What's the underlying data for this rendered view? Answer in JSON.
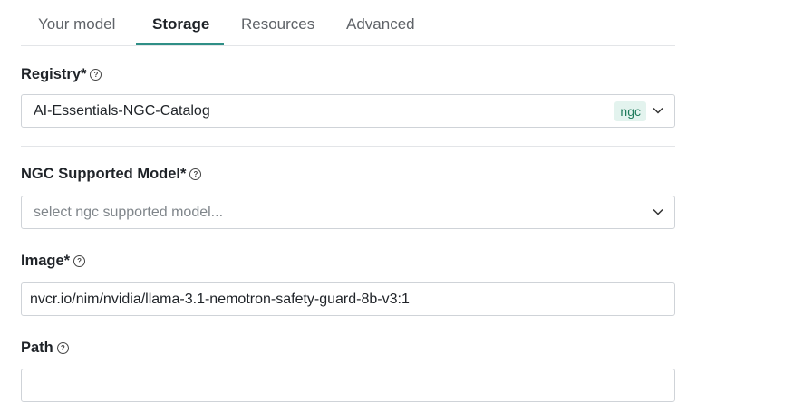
{
  "tabs": [
    {
      "label": "Your model",
      "active": false
    },
    {
      "label": "Storage",
      "active": true
    },
    {
      "label": "Resources",
      "active": false
    },
    {
      "label": "Advanced",
      "active": false
    }
  ],
  "registry": {
    "label": "Registry*",
    "value": "AI-Essentials-NGC-Catalog",
    "badge": "ngc"
  },
  "ngc_model": {
    "label": "NGC Supported Model*",
    "placeholder": "select ngc supported model..."
  },
  "image": {
    "label": "Image*",
    "value": "nvcr.io/nim/nvidia/llama-3.1-nemotron-safety-guard-8b-v3:1"
  },
  "path": {
    "label": "Path"
  },
  "help_glyph": "?",
  "colors": {
    "accent": "#2f8f86",
    "badge_bg": "#e3f3ee",
    "badge_text": "#1e7a5a"
  }
}
